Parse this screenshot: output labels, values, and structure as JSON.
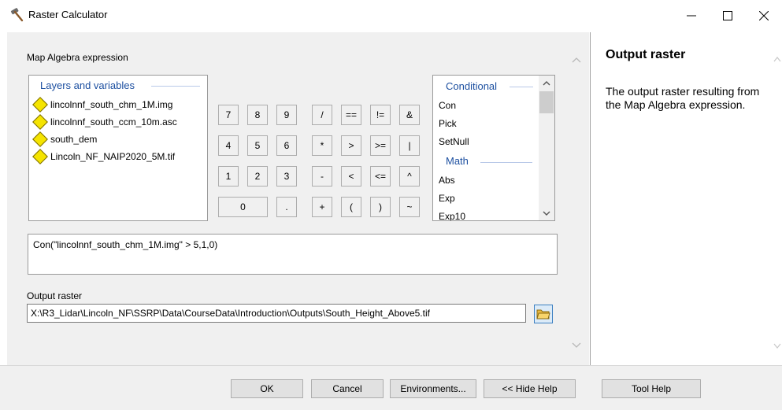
{
  "window": {
    "title": "Raster Calculator",
    "minimize": "—",
    "maximize": "☐",
    "close": "✕"
  },
  "expression_label": "Map Algebra expression",
  "layers": {
    "title": "Layers and variables",
    "items": [
      "lincolnnf_south_chm_1M.img",
      "lincolnnf_south_ccm_10m.asc",
      "south_dem",
      "Lincoln_NF_NAIP2020_5M.tif"
    ]
  },
  "keypad": {
    "r1": [
      "7",
      "8",
      "9",
      "/",
      "==",
      "!=",
      "&"
    ],
    "r2": [
      "4",
      "5",
      "6",
      "*",
      ">",
      ">=",
      "|"
    ],
    "r3": [
      "1",
      "2",
      "3",
      "-",
      "<",
      "<=",
      "^"
    ],
    "r4": [
      "0",
      ".",
      "+",
      "(",
      ")",
      "~"
    ]
  },
  "functions": {
    "conditional_title": "Conditional",
    "conditional": [
      "Con",
      "Pick",
      "SetNull"
    ],
    "math_title": "Math",
    "math": [
      "Abs",
      "Exp",
      "Exp10"
    ]
  },
  "expression": "Con(\"lincolnnf_south_chm_1M.img\" > 5,1,0)",
  "output": {
    "label": "Output raster",
    "value": "X:\\R3_Lidar\\Lincoln_NF\\SSRP\\Data\\CourseData\\Introduction\\Outputs\\South_Height_Above5.tif"
  },
  "buttons": {
    "ok": "OK",
    "cancel": "Cancel",
    "environments": "Environments...",
    "hide_help": "<< Hide Help",
    "tool_help": "Tool Help"
  },
  "help": {
    "title": "Output raster",
    "body": "The output raster resulting from the Map Algebra expression."
  }
}
